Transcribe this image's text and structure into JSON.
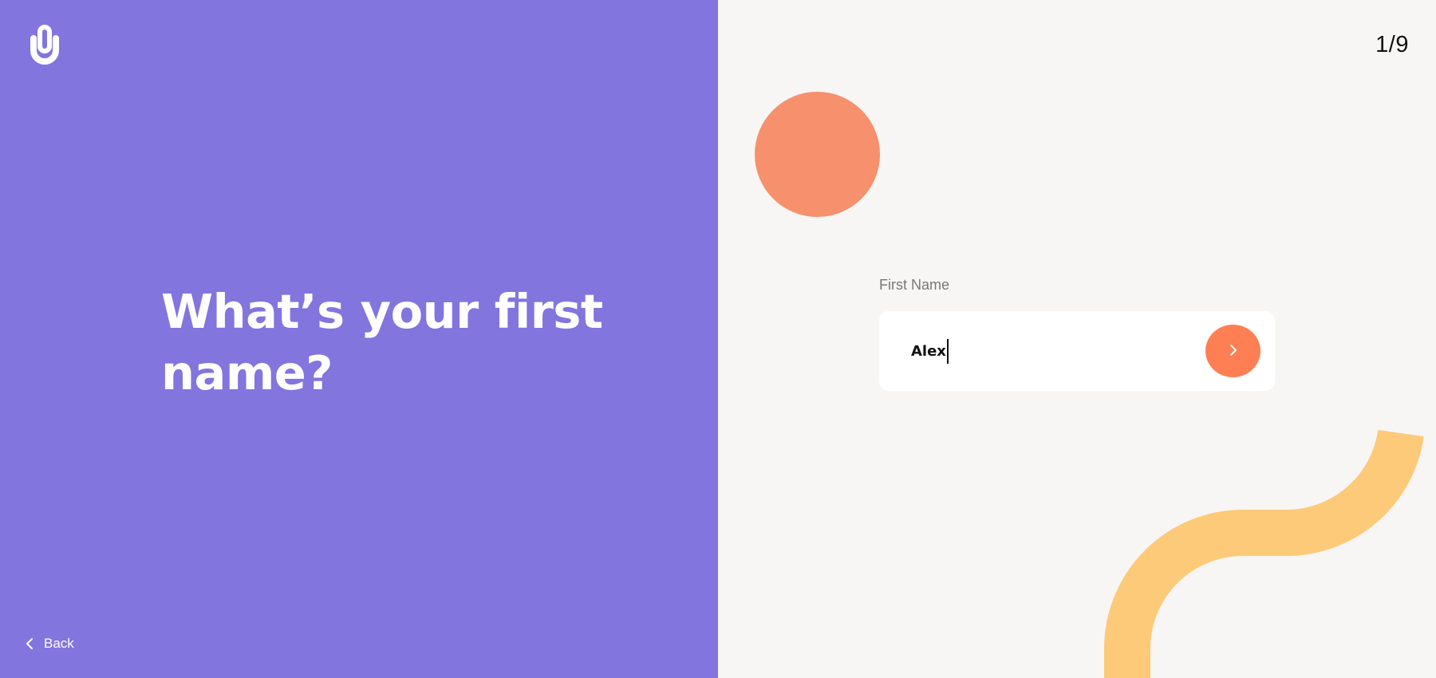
{
  "brand": {
    "logo_icon": "padlock-logo-icon",
    "colors": {
      "primary": "#8275de",
      "accent": "#fd7f53",
      "circle": "#f6906d",
      "wave": "#fdca79",
      "background": "#f8f6f4"
    }
  },
  "progress": {
    "step_label": "1/9"
  },
  "question": {
    "title": "What’s your first name?"
  },
  "form": {
    "field_label": "First Name",
    "value": "Alex",
    "next_icon": "chevron-right-icon"
  },
  "nav": {
    "back_label": "Back",
    "back_icon": "chevron-left-icon"
  }
}
